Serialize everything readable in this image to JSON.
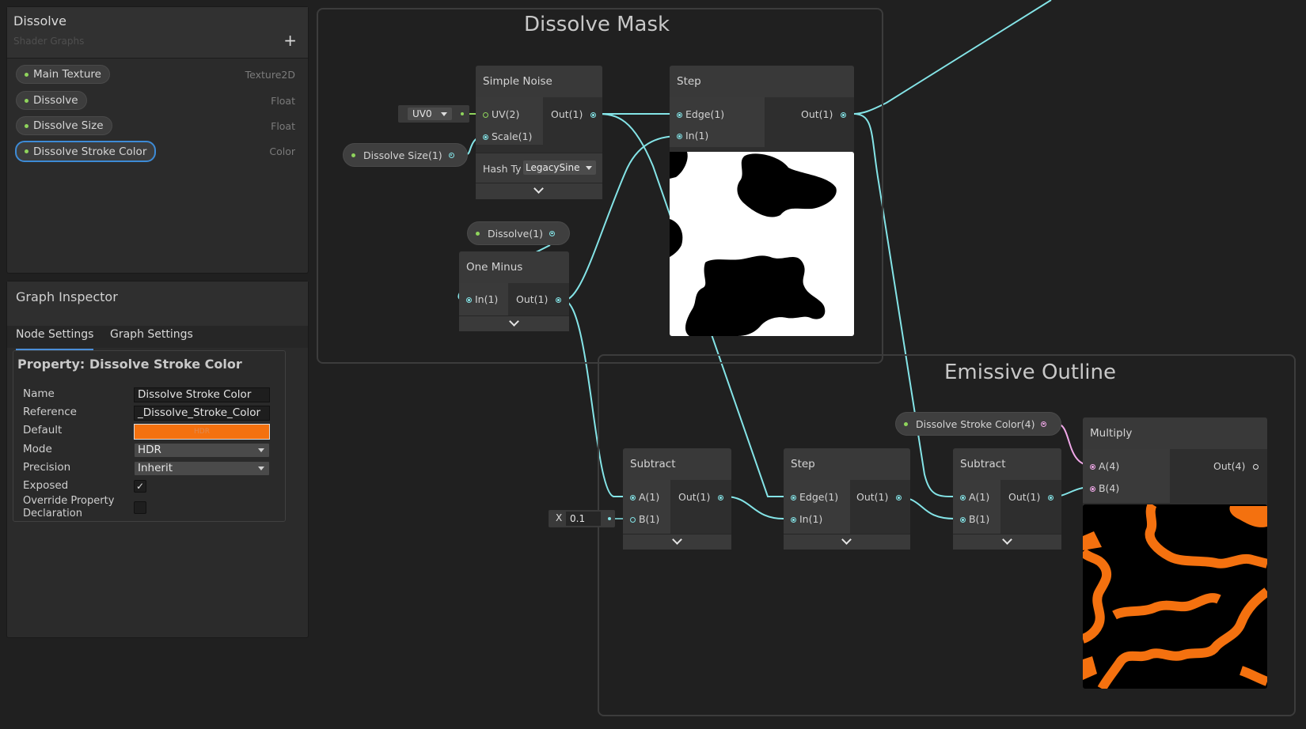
{
  "blackboard": {
    "title": "Dissolve",
    "subtitle": "Shader Graphs",
    "add_icon": "+",
    "properties": [
      {
        "name": "Main Texture",
        "type": "Texture2D"
      },
      {
        "name": "Dissolve",
        "type": "Float"
      },
      {
        "name": "Dissolve Size",
        "type": "Float"
      },
      {
        "name": "Dissolve Stroke Color",
        "type": "Color"
      }
    ]
  },
  "inspector": {
    "title": "Graph Inspector",
    "tabs": [
      "Node Settings",
      "Graph Settings"
    ],
    "property_title": "Property: Dissolve Stroke Color",
    "fields": {
      "name_label": "Name",
      "name_value": "Dissolve Stroke Color",
      "reference_label": "Reference",
      "reference_value": "_Dissolve_Stroke_Color",
      "default_label": "Default",
      "default_badge": "HDR",
      "default_color": "#f4710f",
      "mode_label": "Mode",
      "mode_value": "HDR",
      "precision_label": "Precision",
      "precision_value": "Inherit",
      "exposed_label": "Exposed",
      "exposed_check": "✓",
      "override_label_1": "Override Property",
      "override_label_2": "Declaration"
    }
  },
  "groups": {
    "mask_title": "Dissolve Mask",
    "outline_title": "Emissive Outline"
  },
  "nodes": {
    "simple_noise": {
      "title": "Simple Noise",
      "in_uv": "UV(2)",
      "in_scale": "Scale(1)",
      "out": "Out(1)",
      "hash_label": "Hash Ty",
      "hash_value": "LegacySine"
    },
    "step1": {
      "title": "Step",
      "in_edge": "Edge(1)",
      "in_in": "In(1)",
      "out": "Out(1)"
    },
    "one_minus": {
      "title": "One Minus",
      "in_in": "In(1)",
      "out": "Out(1)"
    },
    "subtract1": {
      "title": "Subtract",
      "in_a": "A(1)",
      "in_b": "B(1)",
      "out": "Out(1)"
    },
    "step2": {
      "title": "Step",
      "in_edge": "Edge(1)",
      "in_in": "In(1)",
      "out": "Out(1)"
    },
    "subtract2": {
      "title": "Subtract",
      "in_a": "A(1)",
      "in_b": "B(1)",
      "out": "Out(1)"
    },
    "multiply": {
      "title": "Multiply",
      "in_a": "A(4)",
      "in_b": "B(4)",
      "out": "Out(4)"
    }
  },
  "property_nodes": {
    "dissolve_size": "Dissolve Size(1)",
    "dissolve": "Dissolve(1)",
    "stroke_color": "Dissolve Stroke Color(4)"
  },
  "inline_inputs": {
    "uv_dropdown": "UV0",
    "b_x_label": "X",
    "b_x_value": "0.1"
  },
  "colors": {
    "wire": "#84e4e7",
    "vector_port": "#f0a8e8",
    "property_dot": "#8fd45c",
    "selection": "#3d8bd6",
    "outline_orange": "#f4710f"
  }
}
